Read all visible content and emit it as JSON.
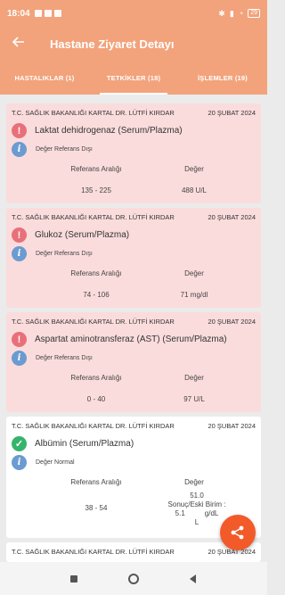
{
  "status_bar": {
    "time": "18:04",
    "battery": "29"
  },
  "appbar": {
    "title": "Hastane Ziyaret Detayı"
  },
  "tabs": [
    {
      "label": "HASTALIKLAR (1)"
    },
    {
      "label": "TETKİKLER (18)"
    },
    {
      "label": "İŞLEMLER (19)"
    }
  ],
  "column_labels": {
    "range": "Referans Aralığı",
    "value": "Değer"
  },
  "tests": [
    {
      "hospital": "T.C. SAĞLIK BAKANLIĞI KARTAL DR. LÜTFİ KIRDAR",
      "date": "20 ŞUBAT 2024",
      "name": "Laktat dehidrogenaz (Serum/Plazma)",
      "status": "Değer Referans Dışı",
      "range": "135 - 225",
      "value": "488 U/L"
    },
    {
      "hospital": "T.C. SAĞLIK BAKANLIĞI KARTAL DR. LÜTFİ KIRDAR",
      "date": "20 ŞUBAT 2024",
      "name": "Glukoz (Serum/Plazma)",
      "status": "Değer Referans Dışı",
      "range": "74 - 106",
      "value": "71 mg/dl"
    },
    {
      "hospital": "T.C. SAĞLIK BAKANLIĞI KARTAL DR. LÜTFİ KIRDAR",
      "date": "20 ŞUBAT 2024",
      "name": "Aspartat aminotransferaz (AST) (Serum/Plazma)",
      "status": "Değer Referans Dışı",
      "range": "0 - 40",
      "value": "97 U/L"
    },
    {
      "hospital": "T.C. SAĞLIK BAKANLIĞI KARTAL DR. LÜTFİ KIRDAR",
      "date": "20 ŞUBAT 2024",
      "name": "Albümin (Serum/Plazma)",
      "status": "Değer Normal",
      "range": "38 - 54",
      "value_line1": "51.0",
      "value_line2": "Sonuç/Eski Birim :",
      "value_line3": "5.1",
      "value_line4": "g/dL",
      "value_line5": "L"
    },
    {
      "hospital": "T.C. SAĞLIK BAKANLIĞI KARTAL DR. LÜTFİ KIRDAR",
      "date": "20 ŞUBAT 2024"
    }
  ],
  "colors": {
    "accent": "#f2a37c",
    "abnormal_bg": "#fbdcdc",
    "warn": "#e8707a",
    "ok": "#35b46c",
    "info": "#6b9bd1",
    "fab": "#f25a2a"
  }
}
